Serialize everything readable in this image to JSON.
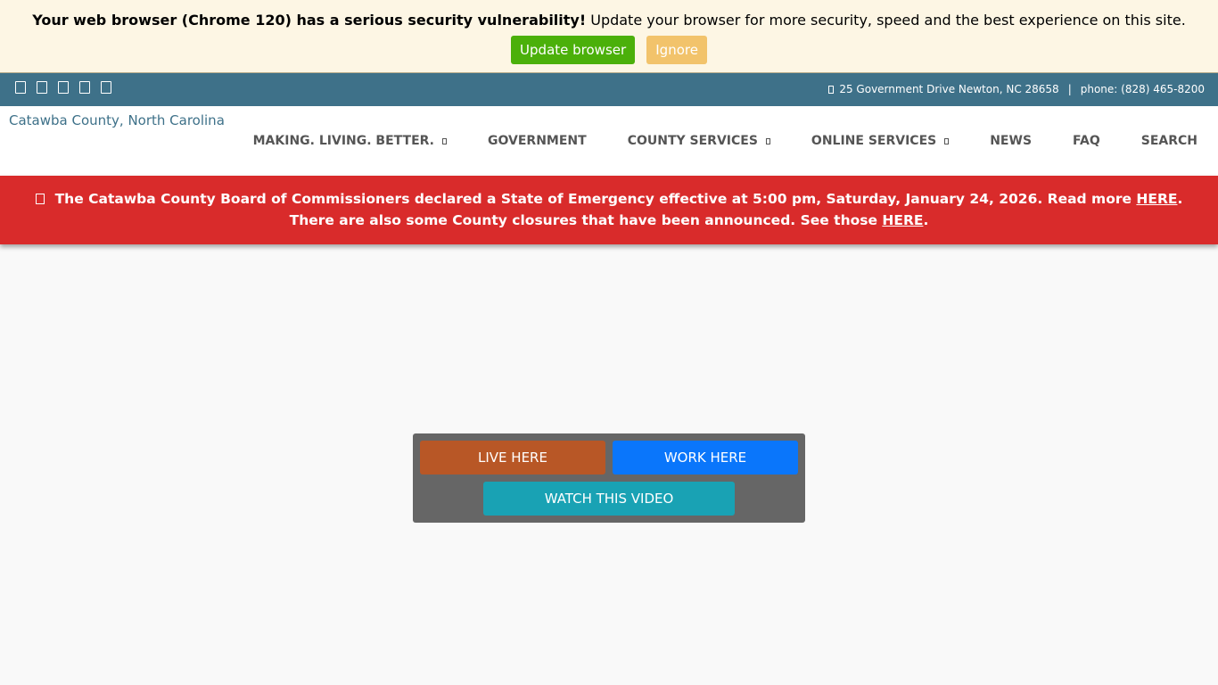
{
  "update_banner": {
    "warning_bold": "Your web browser (Chrome 120) has a serious security vulnerability!",
    "warning_text": " Update your browser for more security, speed and the best experience on this site.",
    "update_label": "Update browser",
    "ignore_label": "Ignore",
    "update_color": "#4bb00a",
    "ignore_color": "#f2c36b"
  },
  "top_bar": {
    "social_icons": [
      "facebook-icon",
      "twitter-icon",
      "instagram-icon",
      "linkedin-icon",
      "youtube-icon"
    ],
    "address": "25 Government Drive Newton, NC 28658",
    "separator": "|",
    "phone": "phone: (828) 465-8200",
    "bg_color": "#3e7189"
  },
  "header": {
    "logo_alt": "Catawba County, North Carolina",
    "nav": [
      {
        "label": "MAKING. LIVING. BETTER.",
        "has_dropdown": true
      },
      {
        "label": "GOVERNMENT",
        "has_dropdown": false
      },
      {
        "label": "COUNTY SERVICES",
        "has_dropdown": true
      },
      {
        "label": "ONLINE SERVICES",
        "has_dropdown": true
      },
      {
        "label": "NEWS",
        "has_dropdown": false
      },
      {
        "label": "FAQ",
        "has_dropdown": false
      },
      {
        "label": "SEARCH",
        "has_dropdown": false
      }
    ]
  },
  "alert": {
    "line1_text": "The Catawba County Board of Commissioners declared a State of Emergency effective at 5:00 pm, Saturday, January 24, 2026. Read more ",
    "line1_link": "HERE",
    "line1_end": ".",
    "line2_text": "There are also some County closures that have been announced. See those ",
    "line2_link": "HERE",
    "line2_end": ".",
    "bg_color": "#d92b2b"
  },
  "cta": {
    "live_label": "LIVE HERE",
    "work_label": "WORK HERE",
    "video_label": "WATCH THIS VIDEO",
    "live_color": "#b85726",
    "work_color": "#0a76fb",
    "video_color": "#19a2b4"
  }
}
